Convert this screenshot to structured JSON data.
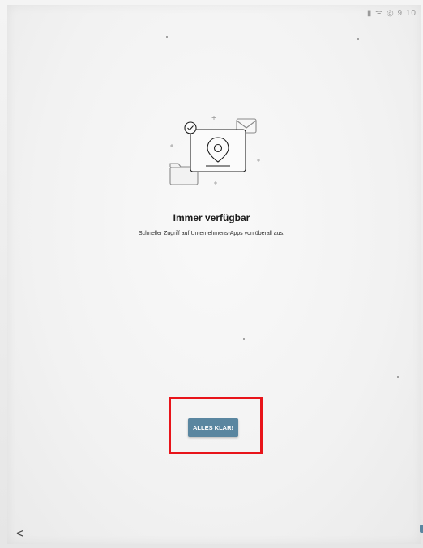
{
  "status_bar": {
    "text": "▮ ᯤ ◎ 9:10"
  },
  "onboarding": {
    "illustration_icon": "map-pin-card-icon",
    "title": "Immer verfügbar",
    "subtitle": "Schneller Zugriff auf Unternehmens-Apps von überall aus."
  },
  "primary_button": {
    "label": "ALLES KLAR!",
    "color": "#5a86a0"
  },
  "annotation": {
    "highlight_color": "#e8141a"
  },
  "navigation": {
    "back_glyph": "<",
    "back_icon": "chevron-left-icon"
  }
}
